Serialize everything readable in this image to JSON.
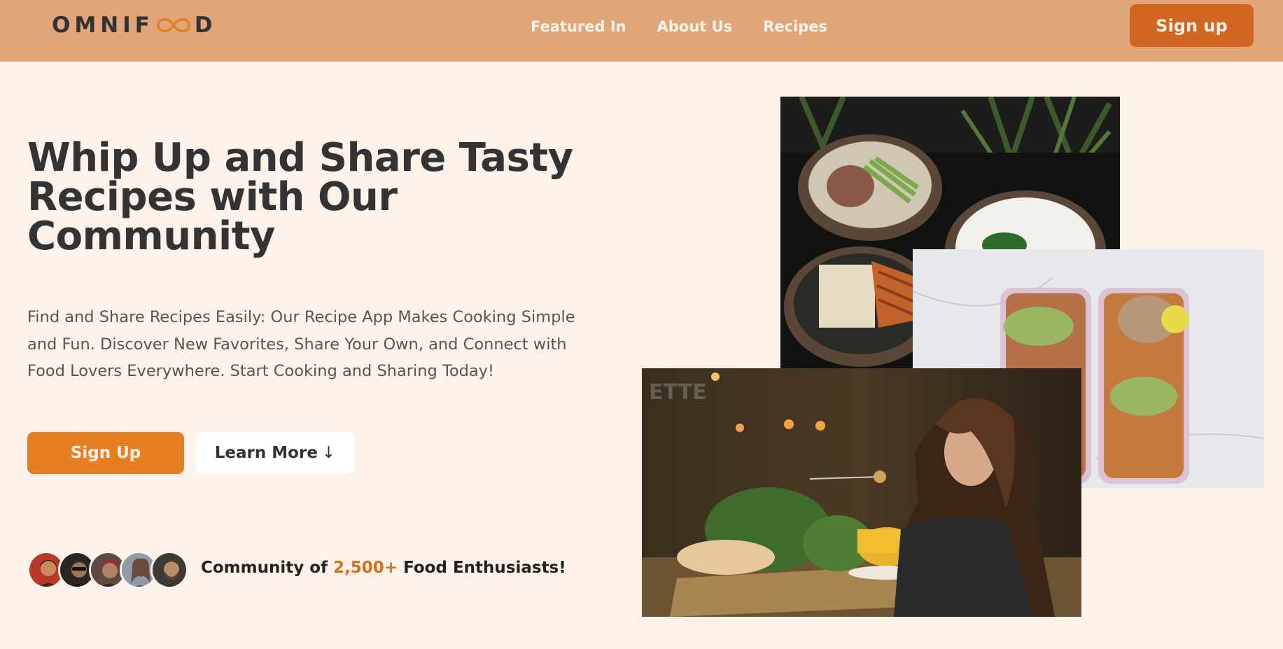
{
  "header": {
    "logo_text_before": "OMNIF",
    "logo_text_after": "D",
    "nav": [
      {
        "label": "Featured In"
      },
      {
        "label": "About Us"
      },
      {
        "label": "Recipes"
      }
    ],
    "signup_label": "Sign up"
  },
  "hero": {
    "title": "Whip Up and Share Tasty Recipes with Our Community",
    "description": "Find and Share Recipes Easily: Our Recipe App Makes Cooking Simple and Fun. Discover New Favorites, Share Your Own, and Connect with Food Lovers Everywhere. Start Cooking and Sharing Today!",
    "primary_button": "Sign Up",
    "secondary_button": "Learn More",
    "secondary_button_icon": "↓",
    "community_prefix": "Community of ",
    "community_count": "2,500+",
    "community_suffix": " Food Enthusiasts!"
  },
  "colors": {
    "header_bg": "#e0a67a",
    "page_bg": "#fdf2e9",
    "primary": "#e67e22",
    "primary_dark": "#d0661f",
    "highlight": "#cf711f"
  },
  "icons": {
    "logo_loop": "infinity-loop-icon",
    "learn_more": "arrow-down-icon"
  }
}
